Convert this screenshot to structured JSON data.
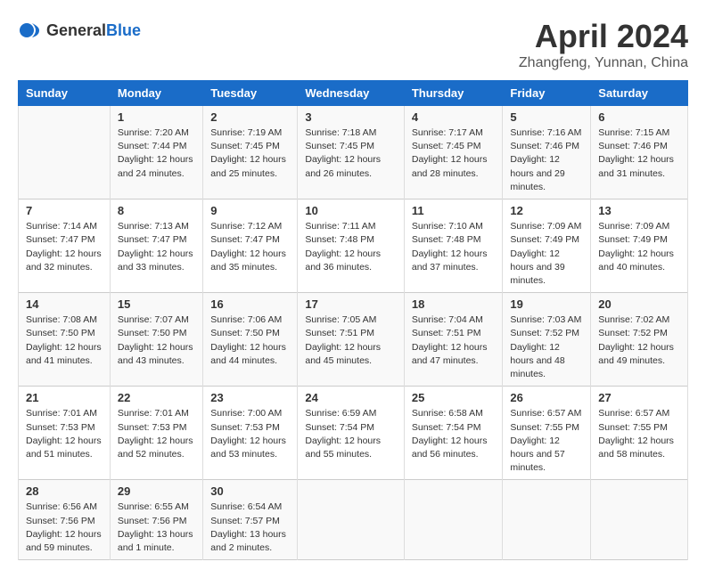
{
  "header": {
    "logo_general": "General",
    "logo_blue": "Blue",
    "month_title": "April 2024",
    "location": "Zhangfeng, Yunnan, China"
  },
  "calendar": {
    "days_of_week": [
      "Sunday",
      "Monday",
      "Tuesday",
      "Wednesday",
      "Thursday",
      "Friday",
      "Saturday"
    ],
    "weeks": [
      [
        {
          "day": "",
          "sunrise": "",
          "sunset": "",
          "daylight": ""
        },
        {
          "day": "1",
          "sunrise": "Sunrise: 7:20 AM",
          "sunset": "Sunset: 7:44 PM",
          "daylight": "Daylight: 12 hours and 24 minutes."
        },
        {
          "day": "2",
          "sunrise": "Sunrise: 7:19 AM",
          "sunset": "Sunset: 7:45 PM",
          "daylight": "Daylight: 12 hours and 25 minutes."
        },
        {
          "day": "3",
          "sunrise": "Sunrise: 7:18 AM",
          "sunset": "Sunset: 7:45 PM",
          "daylight": "Daylight: 12 hours and 26 minutes."
        },
        {
          "day": "4",
          "sunrise": "Sunrise: 7:17 AM",
          "sunset": "Sunset: 7:45 PM",
          "daylight": "Daylight: 12 hours and 28 minutes."
        },
        {
          "day": "5",
          "sunrise": "Sunrise: 7:16 AM",
          "sunset": "Sunset: 7:46 PM",
          "daylight": "Daylight: 12 hours and 29 minutes."
        },
        {
          "day": "6",
          "sunrise": "Sunrise: 7:15 AM",
          "sunset": "Sunset: 7:46 PM",
          "daylight": "Daylight: 12 hours and 31 minutes."
        }
      ],
      [
        {
          "day": "7",
          "sunrise": "Sunrise: 7:14 AM",
          "sunset": "Sunset: 7:47 PM",
          "daylight": "Daylight: 12 hours and 32 minutes."
        },
        {
          "day": "8",
          "sunrise": "Sunrise: 7:13 AM",
          "sunset": "Sunset: 7:47 PM",
          "daylight": "Daylight: 12 hours and 33 minutes."
        },
        {
          "day": "9",
          "sunrise": "Sunrise: 7:12 AM",
          "sunset": "Sunset: 7:47 PM",
          "daylight": "Daylight: 12 hours and 35 minutes."
        },
        {
          "day": "10",
          "sunrise": "Sunrise: 7:11 AM",
          "sunset": "Sunset: 7:48 PM",
          "daylight": "Daylight: 12 hours and 36 minutes."
        },
        {
          "day": "11",
          "sunrise": "Sunrise: 7:10 AM",
          "sunset": "Sunset: 7:48 PM",
          "daylight": "Daylight: 12 hours and 37 minutes."
        },
        {
          "day": "12",
          "sunrise": "Sunrise: 7:09 AM",
          "sunset": "Sunset: 7:49 PM",
          "daylight": "Daylight: 12 hours and 39 minutes."
        },
        {
          "day": "13",
          "sunrise": "Sunrise: 7:09 AM",
          "sunset": "Sunset: 7:49 PM",
          "daylight": "Daylight: 12 hours and 40 minutes."
        }
      ],
      [
        {
          "day": "14",
          "sunrise": "Sunrise: 7:08 AM",
          "sunset": "Sunset: 7:50 PM",
          "daylight": "Daylight: 12 hours and 41 minutes."
        },
        {
          "day": "15",
          "sunrise": "Sunrise: 7:07 AM",
          "sunset": "Sunset: 7:50 PM",
          "daylight": "Daylight: 12 hours and 43 minutes."
        },
        {
          "day": "16",
          "sunrise": "Sunrise: 7:06 AM",
          "sunset": "Sunset: 7:50 PM",
          "daylight": "Daylight: 12 hours and 44 minutes."
        },
        {
          "day": "17",
          "sunrise": "Sunrise: 7:05 AM",
          "sunset": "Sunset: 7:51 PM",
          "daylight": "Daylight: 12 hours and 45 minutes."
        },
        {
          "day": "18",
          "sunrise": "Sunrise: 7:04 AM",
          "sunset": "Sunset: 7:51 PM",
          "daylight": "Daylight: 12 hours and 47 minutes."
        },
        {
          "day": "19",
          "sunrise": "Sunrise: 7:03 AM",
          "sunset": "Sunset: 7:52 PM",
          "daylight": "Daylight: 12 hours and 48 minutes."
        },
        {
          "day": "20",
          "sunrise": "Sunrise: 7:02 AM",
          "sunset": "Sunset: 7:52 PM",
          "daylight": "Daylight: 12 hours and 49 minutes."
        }
      ],
      [
        {
          "day": "21",
          "sunrise": "Sunrise: 7:01 AM",
          "sunset": "Sunset: 7:53 PM",
          "daylight": "Daylight: 12 hours and 51 minutes."
        },
        {
          "day": "22",
          "sunrise": "Sunrise: 7:01 AM",
          "sunset": "Sunset: 7:53 PM",
          "daylight": "Daylight: 12 hours and 52 minutes."
        },
        {
          "day": "23",
          "sunrise": "Sunrise: 7:00 AM",
          "sunset": "Sunset: 7:53 PM",
          "daylight": "Daylight: 12 hours and 53 minutes."
        },
        {
          "day": "24",
          "sunrise": "Sunrise: 6:59 AM",
          "sunset": "Sunset: 7:54 PM",
          "daylight": "Daylight: 12 hours and 55 minutes."
        },
        {
          "day": "25",
          "sunrise": "Sunrise: 6:58 AM",
          "sunset": "Sunset: 7:54 PM",
          "daylight": "Daylight: 12 hours and 56 minutes."
        },
        {
          "day": "26",
          "sunrise": "Sunrise: 6:57 AM",
          "sunset": "Sunset: 7:55 PM",
          "daylight": "Daylight: 12 hours and 57 minutes."
        },
        {
          "day": "27",
          "sunrise": "Sunrise: 6:57 AM",
          "sunset": "Sunset: 7:55 PM",
          "daylight": "Daylight: 12 hours and 58 minutes."
        }
      ],
      [
        {
          "day": "28",
          "sunrise": "Sunrise: 6:56 AM",
          "sunset": "Sunset: 7:56 PM",
          "daylight": "Daylight: 12 hours and 59 minutes."
        },
        {
          "day": "29",
          "sunrise": "Sunrise: 6:55 AM",
          "sunset": "Sunset: 7:56 PM",
          "daylight": "Daylight: 13 hours and 1 minute."
        },
        {
          "day": "30",
          "sunrise": "Sunrise: 6:54 AM",
          "sunset": "Sunset: 7:57 PM",
          "daylight": "Daylight: 13 hours and 2 minutes."
        },
        {
          "day": "",
          "sunrise": "",
          "sunset": "",
          "daylight": ""
        },
        {
          "day": "",
          "sunrise": "",
          "sunset": "",
          "daylight": ""
        },
        {
          "day": "",
          "sunrise": "",
          "sunset": "",
          "daylight": ""
        },
        {
          "day": "",
          "sunrise": "",
          "sunset": "",
          "daylight": ""
        }
      ]
    ]
  }
}
